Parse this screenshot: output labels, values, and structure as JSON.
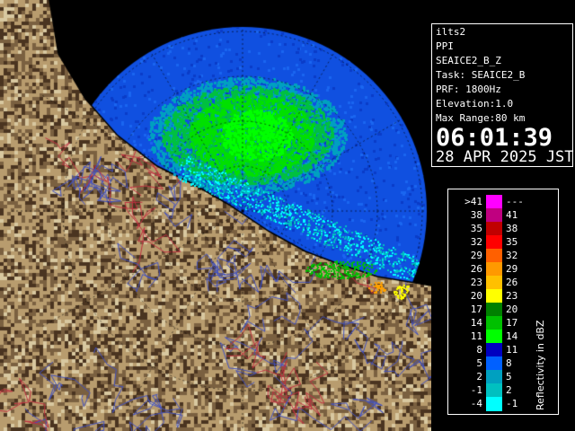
{
  "radar": {
    "colors": {
      "sea": "#1050e0",
      "land_light": "#b89c6e",
      "land_dark": "#4a3420",
      "background": "#000000"
    }
  },
  "info": {
    "lines": [
      "ilts2",
      "PPI",
      "SEAICE2_B_Z",
      "Task: SEAICE2_B",
      "PRF: 1800Hz",
      "Elevation:1.0",
      "Max Range:80 km"
    ],
    "time": "06:01:39",
    "date": "28 APR 2025 JST"
  },
  "scale": {
    "title": "Reflectivity in dBZ",
    "bins": [
      {
        "low": ">41",
        "high": "---",
        "color": "#ff00ff"
      },
      {
        "low": "38",
        "high": "41",
        "color": "#c00080"
      },
      {
        "low": "35",
        "high": "38",
        "color": "#c00000"
      },
      {
        "low": "32",
        "high": "35",
        "color": "#ff0000"
      },
      {
        "low": "29",
        "high": "32",
        "color": "#ff6000"
      },
      {
        "low": "26",
        "high": "29",
        "color": "#ff9900"
      },
      {
        "low": "23",
        "high": "26",
        "color": "#ffc000"
      },
      {
        "low": "20",
        "high": "23",
        "color": "#ffff00"
      },
      {
        "low": "17",
        "high": "20",
        "color": "#008000"
      },
      {
        "low": "14",
        "high": "17",
        "color": "#00c000"
      },
      {
        "low": "11",
        "high": "14",
        "color": "#00ff00"
      },
      {
        "low": "8",
        "high": "11",
        "color": "#0000c0"
      },
      {
        "low": "5",
        "high": "8",
        "color": "#0060ff"
      },
      {
        "low": "2",
        "high": "5",
        "color": "#00a0c0"
      },
      {
        "low": "-1",
        "high": "2",
        "color": "#00c0c0"
      },
      {
        "low": "-4",
        "high": "-1",
        "color": "#00ffff"
      }
    ]
  }
}
